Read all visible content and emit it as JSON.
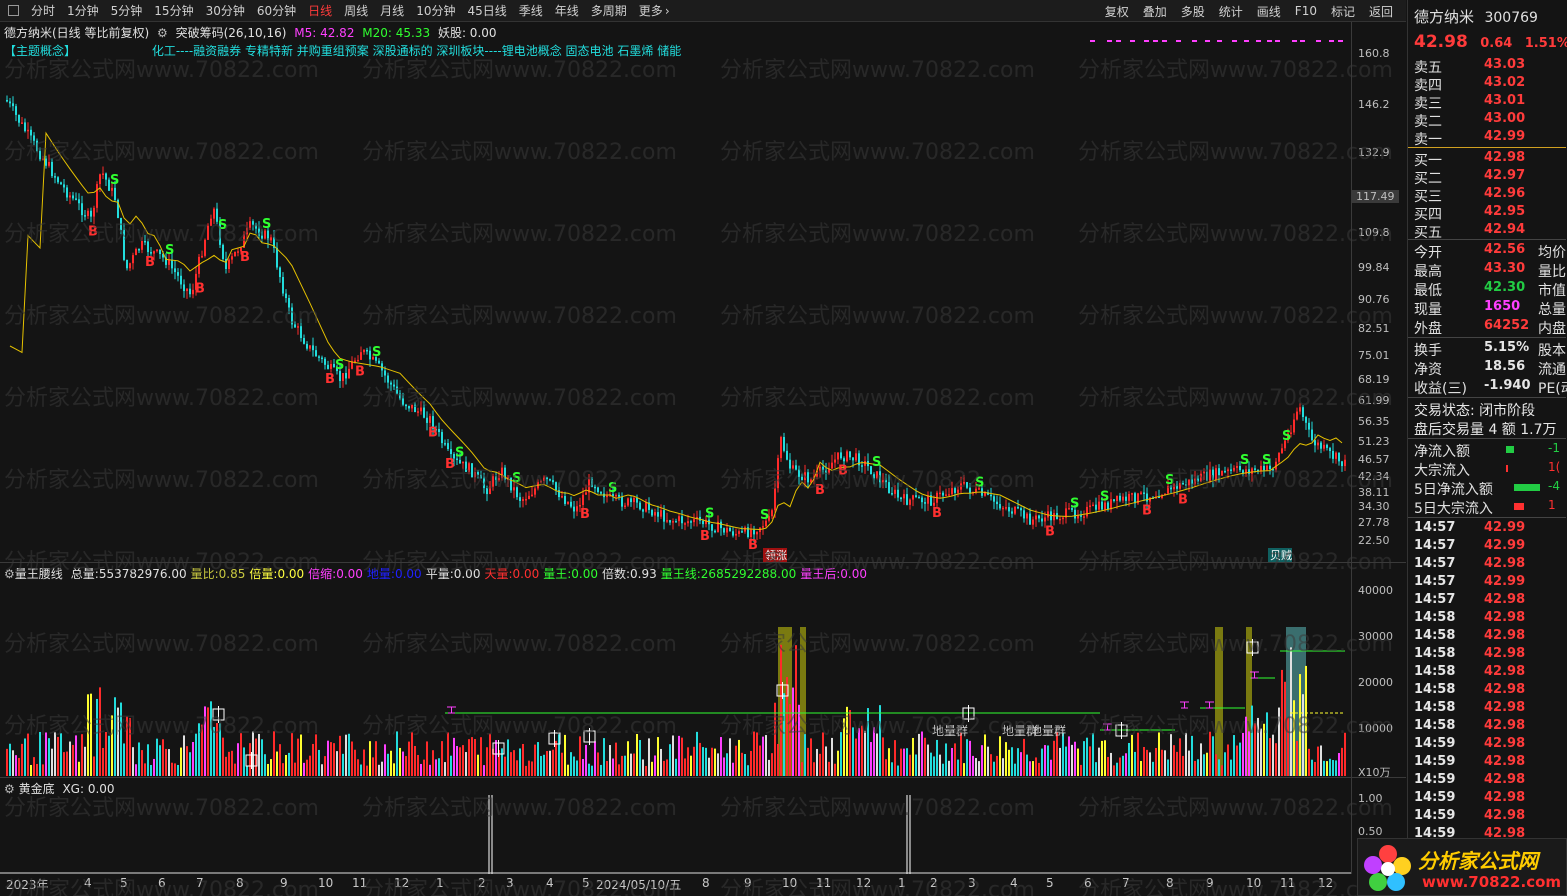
{
  "topbar": {
    "tabs": [
      "分时",
      "1分钟",
      "5分钟",
      "15分钟",
      "30分钟",
      "60分钟",
      "日线",
      "周线",
      "月线",
      "10分钟",
      "45日线",
      "季线",
      "年线",
      "多周期",
      "更多"
    ],
    "active": "日线",
    "right": [
      "复权",
      "叠加",
      "多股",
      "统计",
      "画线",
      "F10",
      "标记",
      "返回"
    ]
  },
  "info": {
    "stock_title": "德方纳米(日线 等比前复权)",
    "indicator": "突破筹码(26,10,16)",
    "m5": "M5: 42.82",
    "m20": "M20: 45.33",
    "yao": "妖股: 0.00"
  },
  "concepts": {
    "tag": "【主题概念】",
    "text": "化工----融资融券 专精特新 并购重组预案 深股通标的 深圳板块----锂电池概念 固态电池 石墨烯 储能"
  },
  "price_axis": [
    "160.8",
    "146.2",
    "132.9",
    "117.49",
    "109.8",
    "99.84",
    "90.76",
    "82.51",
    "75.01",
    "68.19",
    "61.99",
    "56.35",
    "51.23",
    "46.57",
    "42.34",
    "38.11",
    "34.30",
    "27.78",
    "22.50"
  ],
  "volume_panel": {
    "name": "量王腰线",
    "items": [
      {
        "k": "总量:",
        "v": "553782976.00",
        "c": "#e0e0e0"
      },
      {
        "k": "量比:",
        "v": "0.85",
        "c": "#c8c840"
      },
      {
        "k": "倍量:",
        "v": "0.00",
        "c": "#ffff40"
      },
      {
        "k": "倍缩:",
        "v": "0.00",
        "c": "#ff40ff"
      },
      {
        "k": "地量:",
        "v": "0.00",
        "c": "#2020ff"
      },
      {
        "k": "平量:",
        "v": "0.00",
        "c": "#e0e0e0"
      },
      {
        "k": "天量:",
        "v": "0.00",
        "c": "#ff3030"
      },
      {
        "k": "量王:",
        "v": "0.00",
        "c": "#30ff30"
      },
      {
        "k": "倍数:",
        "v": "0.93",
        "c": "#e0e0e0"
      },
      {
        "k": "量王线:",
        "v": "2685292288.00",
        "c": "#30ff30"
      },
      {
        "k": "量王后:",
        "v": "0.00",
        "c": "#ff40ff"
      }
    ],
    "axis": [
      "40000",
      "30000",
      "20000",
      "10000",
      "X10万"
    ],
    "labels": [
      "地量群",
      "地量群",
      "地量群"
    ]
  },
  "gold_panel": {
    "name": "黄金底",
    "value": "XG: 0.00",
    "axis": [
      "1.00",
      "0.50"
    ]
  },
  "time_axis": [
    "2023年",
    "4",
    "5",
    "6",
    "7",
    "8",
    "9",
    "10",
    "11",
    "12",
    "1",
    "2",
    "3",
    "4",
    "5",
    "2024/05/10/五",
    "8",
    "9",
    "10",
    "11",
    "12",
    "1",
    "2",
    "3",
    "4",
    "5",
    "6",
    "7",
    "8",
    "9",
    "10",
    "11",
    "12"
  ],
  "chart_marks": {
    "rise_label": "领涨",
    "buy_label": "贝贼"
  },
  "quote": {
    "name": "德方纳米",
    "code": "300769",
    "price": "42.98",
    "change": "0.64",
    "pct": "1.51%",
    "asks": [
      {
        "l": "卖五",
        "p": "43.03"
      },
      {
        "l": "卖四",
        "p": "43.02"
      },
      {
        "l": "卖三",
        "p": "43.01"
      },
      {
        "l": "卖二",
        "p": "43.00"
      },
      {
        "l": "卖一",
        "p": "42.99"
      }
    ],
    "bids": [
      {
        "l": "买一",
        "p": "42.98"
      },
      {
        "l": "买二",
        "p": "42.97"
      },
      {
        "l": "买三",
        "p": "42.96"
      },
      {
        "l": "买四",
        "p": "42.95"
      },
      {
        "l": "买五",
        "p": "42.94"
      }
    ],
    "stats": [
      {
        "l": "今开",
        "v": "42.56",
        "c": "red",
        "r": "均价"
      },
      {
        "l": "最高",
        "v": "43.30",
        "c": "red",
        "r": "量比"
      },
      {
        "l": "最低",
        "v": "42.30",
        "c": "green",
        "r": "市值"
      },
      {
        "l": "现量",
        "v": "1650",
        "c": "mag",
        "r": "总量"
      },
      {
        "l": "外盘",
        "v": "64252",
        "c": "red",
        "r": "内盘"
      }
    ],
    "stats2": [
      {
        "l": "换手",
        "v": "5.15%",
        "r": "股本"
      },
      {
        "l": "净资",
        "v": "18.56",
        "r": "流通"
      },
      {
        "l": "收益(三)",
        "v": "-1.940",
        "r": "PE(动"
      }
    ],
    "trade_status": "交易状态: 闭市阶段",
    "after_hours": "盘后交易量 4 额 1.7万",
    "flows": [
      {
        "l": "净流入额",
        "v": "-1"
      },
      {
        "l": "大宗流入",
        "v": "1("
      },
      {
        "l": "5日净流入额",
        "v": "-4"
      },
      {
        "l": "5日大宗流入",
        "v": "1"
      }
    ],
    "ticks": [
      {
        "t": "14:57",
        "p": "42.99"
      },
      {
        "t": "14:57",
        "p": "42.99"
      },
      {
        "t": "14:57",
        "p": "42.98"
      },
      {
        "t": "14:57",
        "p": "42.99"
      },
      {
        "t": "14:57",
        "p": "42.98"
      },
      {
        "t": "14:58",
        "p": "42.98"
      },
      {
        "t": "14:58",
        "p": "42.98"
      },
      {
        "t": "14:58",
        "p": "42.98"
      },
      {
        "t": "14:58",
        "p": "42.98"
      },
      {
        "t": "14:58",
        "p": "42.98"
      },
      {
        "t": "14:58",
        "p": "42.98"
      },
      {
        "t": "14:58",
        "p": "42.98"
      },
      {
        "t": "14:59",
        "p": "42.98"
      },
      {
        "t": "14:59",
        "p": "42.98"
      },
      {
        "t": "14:59",
        "p": "42.98"
      },
      {
        "t": "14:59",
        "p": "42.98"
      },
      {
        "t": "14:59",
        "p": "42.98"
      },
      {
        "t": "14:59",
        "p": "42.98"
      }
    ]
  },
  "watermark": "分析家公式网www.70822.com",
  "logo": {
    "text": "分析家公式网",
    "url": "www.70822.com"
  },
  "colors": {
    "up": "#ff2a2a",
    "down": "#22dddd",
    "ma": "#e6c200",
    "buy": "#ff3030",
    "sell": "#30ff30"
  }
}
